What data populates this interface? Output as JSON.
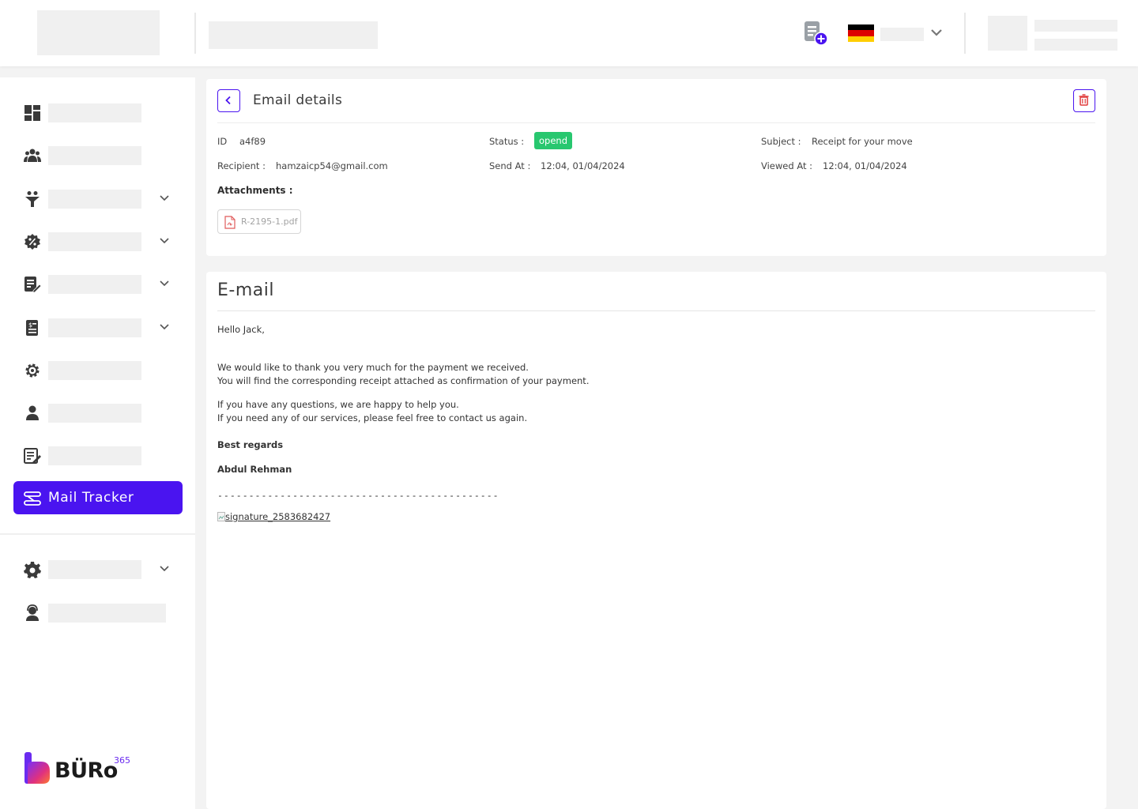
{
  "sidebar": {
    "active_item": {
      "label": "Mail Tracker",
      "icon": "mail-tracker-icon"
    },
    "items": [
      {
        "icon": "dashboard-icon",
        "has_submenu": false
      },
      {
        "icon": "users-icon",
        "has_submenu": false
      },
      {
        "icon": "funnel-icon",
        "has_submenu": true
      },
      {
        "icon": "discount-icon",
        "has_submenu": true
      },
      {
        "icon": "edit-document-icon",
        "has_submenu": true
      },
      {
        "icon": "invoice-icon",
        "has_submenu": true
      },
      {
        "icon": "settings-gear-icon",
        "has_submenu": false
      },
      {
        "icon": "person-icon",
        "has_submenu": false
      },
      {
        "icon": "note-edit-icon",
        "has_submenu": false
      }
    ],
    "bottom_items": [
      {
        "icon": "gear-icon",
        "has_submenu": true
      },
      {
        "icon": "support-icon",
        "has_submenu": false
      }
    ],
    "logo": {
      "text": "BÜRo",
      "superscript": "365"
    }
  },
  "header": {
    "language_flag": "germany",
    "accent_color": "#4a14f0"
  },
  "email_details": {
    "title": "Email details",
    "fields": {
      "id_label": "ID",
      "id_value": "a4f89",
      "status_label": "Status :",
      "status_value": "opend",
      "subject_label": "Subject :",
      "subject_value": "Receipt for your move",
      "recipient_label": "Recipient :",
      "recipient_value": "hamzaicp54@gmail.com",
      "send_at_label": "Send At :",
      "send_at_value": "12:04, 01/04/2024",
      "viewed_at_label": "Viewed At :",
      "viewed_at_value": "12:04, 01/04/2024"
    },
    "attachments_label": "Attachments :",
    "attachments": [
      {
        "name": "R-2195-1.pdf"
      }
    ],
    "status_color": "#28c76f"
  },
  "email": {
    "title": "E-mail",
    "greeting": "Hello Jack,",
    "para1_line1": "We would like to thank you very much for the payment we received.",
    "para1_line2": "You will find the corresponding receipt attached as confirmation of your payment.",
    "para2_line1": "If you have any questions, we are happy to help you.",
    "para2_line2": "If you need any of our services, please feel free to contact us again.",
    "closing": "Best regards",
    "signature_name": "Abdul Rehman",
    "separator": "---------------------------------------------",
    "signature_image_alt": "signature_2583682427"
  }
}
